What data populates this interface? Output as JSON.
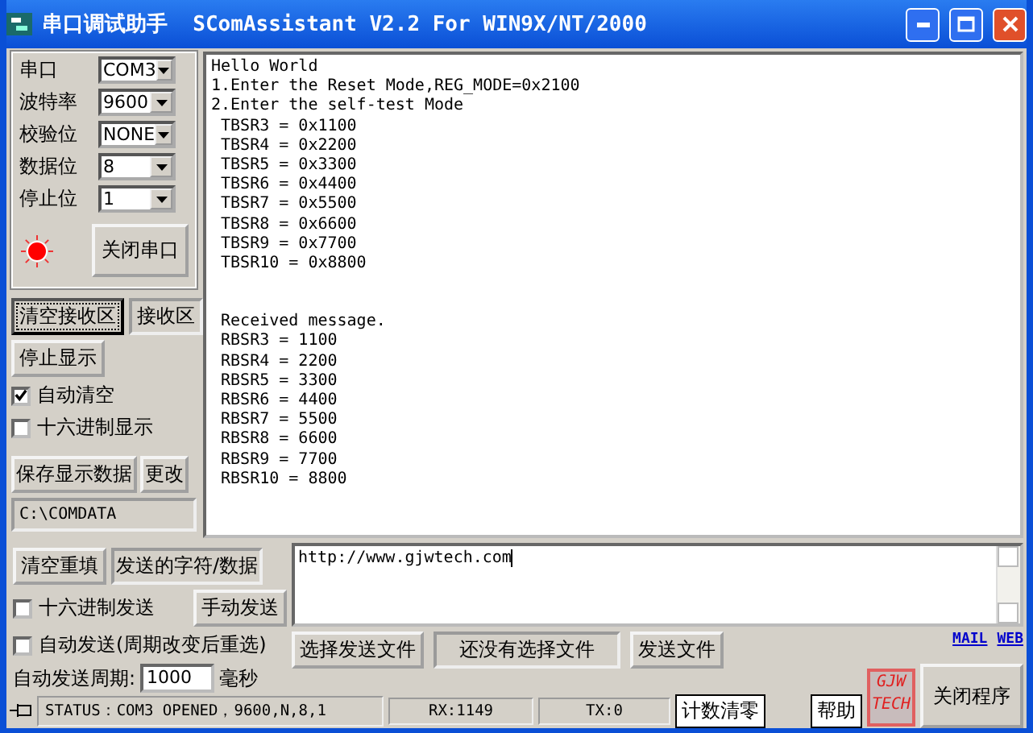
{
  "window": {
    "title": "串口调试助手  SComAssistant V2.2 For WIN9X/NT/2000"
  },
  "port_settings": [
    {
      "label": "串口",
      "value": "COM3"
    },
    {
      "label": "波特率",
      "value": "9600"
    },
    {
      "label": "校验位",
      "value": "NONE"
    },
    {
      "label": "数据位",
      "value": "8"
    },
    {
      "label": "停止位",
      "value": "1"
    }
  ],
  "port_indicator": {
    "on": true
  },
  "close_port_button": "关闭串口",
  "clear_receive_button": "清空接收区",
  "receive_label": "接收区",
  "stop_display_button": "停止显示",
  "receive_options": [
    {
      "label": "自动清空",
      "checked": true
    },
    {
      "label": "十六进制显示",
      "checked": false
    }
  ],
  "save_data_button": "保存显示数据",
  "change_button": "更改",
  "save_path": "C:\\COMDATA",
  "receive_lines": [
    "Hello World",
    "1.Enter the Reset Mode,REG_MODE=0x2100",
    "2.Enter the self-test Mode",
    " TBSR3 = 0x1100",
    " TBSR4 = 0x2200",
    " TBSR5 = 0x3300",
    " TBSR6 = 0x4400",
    " TBSR7 = 0x5500",
    " TBSR8 = 0x6600",
    " TBSR9 = 0x7700",
    " TBSR10 = 0x8800"
  ],
  "received_message_lines": [
    " Received message.",
    " RBSR3 = 1100",
    " RBSR4 = 2200",
    " RBSR5 = 3300",
    " RBSR6 = 4400",
    " RBSR7 = 5500",
    " RBSR8 = 6600",
    " RBSR9 = 7700",
    " RBSR10 = 8800"
  ],
  "clear_send_button": "清空重填",
  "send_label": "发送的字符/数据",
  "hex_send": {
    "label": "十六进制发送",
    "checked": false
  },
  "manual_send_button": "手动发送",
  "auto_send": {
    "label": "自动发送(周期改变后重选)",
    "checked": false
  },
  "period": {
    "label": "自动发送周期:",
    "value": "1000",
    "unit": "毫秒"
  },
  "send_text": "http://www.gjwtech.com",
  "choose_file_button": "选择发送文件",
  "file_status": "还没有选择文件",
  "send_file_button": "发送文件",
  "links": [
    "MAIL",
    "WEB"
  ],
  "logo": [
    "GJW",
    "TECH"
  ],
  "help_button": "帮助",
  "close_program_button": "关闭程序",
  "status_bar": {
    "status": "STATUS：COM3 OPENED，9600,N,8,1",
    "rx": "RX:1149",
    "tx": "TX:0",
    "reset_button": "计数清零"
  }
}
